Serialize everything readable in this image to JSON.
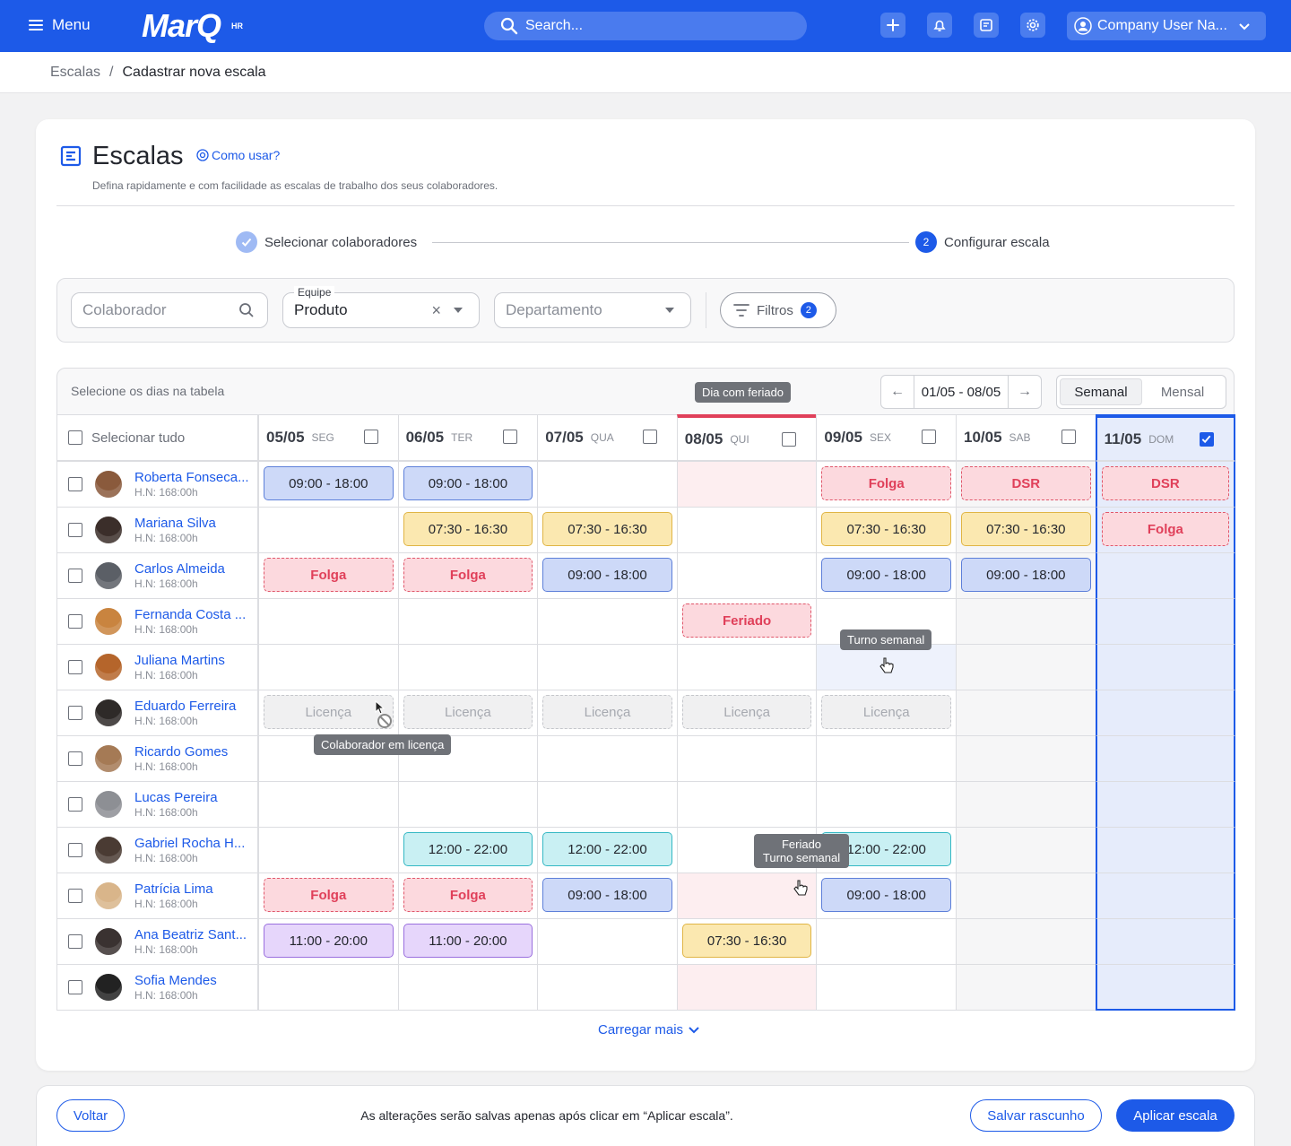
{
  "topbar": {
    "menu_label": "Menu",
    "logo_text": "MarQ",
    "logo_sup": "HR",
    "search_placeholder": "Search...",
    "user_name": "Company User Na...",
    "icons": [
      "plus-icon",
      "bell-icon",
      "notes-icon",
      "gear-icon"
    ]
  },
  "breadcrumb": {
    "parent": "Escalas",
    "separator": "/",
    "current": "Cadastrar nova escala"
  },
  "page": {
    "title": "Escalas",
    "how_to": "Como usar?",
    "subtitle": "Defina rapidamente e com facilidade as escalas de trabalho dos seus colaboradores."
  },
  "stepper": {
    "step1_label": "Selecionar colaboradores",
    "step2_number": "2",
    "step2_label": "Configurar escala"
  },
  "filters": {
    "colaborador_placeholder": "Colaborador",
    "equipe_label": "Equipe",
    "equipe_value": "Produto",
    "departamento_placeholder": "Departamento",
    "filtros_label": "Filtros",
    "filtros_count": "2"
  },
  "table": {
    "hint": "Selecione os dias na tabela",
    "range": "01/05 - 08/05",
    "view_weekly": "Semanal",
    "view_monthly": "Mensal",
    "select_all": "Selecionar tudo",
    "days": [
      {
        "date": "05/05",
        "dow": "SEG",
        "checked": false,
        "holiday": false
      },
      {
        "date": "06/05",
        "dow": "TER",
        "checked": false,
        "holiday": false
      },
      {
        "date": "07/05",
        "dow": "QUA",
        "checked": false,
        "holiday": false
      },
      {
        "date": "08/05",
        "dow": "QUI",
        "checked": false,
        "holiday": true
      },
      {
        "date": "09/05",
        "dow": "SEX",
        "checked": false,
        "holiday": false
      },
      {
        "date": "10/05",
        "dow": "SAB",
        "checked": false,
        "holiday": false
      },
      {
        "date": "11/05",
        "dow": "DOM",
        "checked": true,
        "holiday": false
      }
    ],
    "rows": [
      {
        "name": "Roberta Fonseca...",
        "hours": "H.N: 168:00h",
        "avatar": "#8a5a3c",
        "cells": [
          [
            "09:00 - 18:00",
            "blue"
          ],
          [
            "09:00 - 18:00",
            "blue"
          ],
          null,
          null,
          [
            "Folga",
            "red"
          ],
          [
            "DSR",
            "red"
          ],
          [
            "DSR",
            "red"
          ]
        ]
      },
      {
        "name": "Mariana Silva",
        "hours": "H.N: 168:00h",
        "avatar": "#3b2e2a",
        "cells": [
          null,
          [
            "07:30 - 16:30",
            "yellow"
          ],
          [
            "07:30 - 16:30",
            "yellow"
          ],
          null,
          [
            "07:30 - 16:30",
            "yellow"
          ],
          [
            "07:30 - 16:30",
            "yellow"
          ],
          [
            "Folga",
            "red"
          ]
        ]
      },
      {
        "name": "Carlos Almeida",
        "hours": "H.N: 168:00h",
        "avatar": "#5b5f66",
        "cells": [
          [
            "Folga",
            "red"
          ],
          [
            "Folga",
            "red"
          ],
          [
            "09:00 - 18:00",
            "blue"
          ],
          null,
          [
            "09:00 - 18:00",
            "blue"
          ],
          [
            "09:00 - 18:00",
            "blue"
          ],
          null
        ]
      },
      {
        "name": "Fernanda Costa ...",
        "hours": "H.N: 168:00h",
        "avatar": "#c9843f",
        "cells": [
          null,
          null,
          null,
          [
            "Feriado",
            "red"
          ],
          null,
          null,
          null
        ]
      },
      {
        "name": "Juliana Martins",
        "hours": "H.N: 168:00h",
        "avatar": "#b5652b",
        "cells": [
          null,
          null,
          null,
          null,
          null,
          null,
          null
        ]
      },
      {
        "name": "Eduardo Ferreira",
        "hours": "H.N: 168:00h",
        "avatar": "#2e2a28",
        "cells": [
          [
            "Licença",
            "gray"
          ],
          [
            "Licença",
            "gray"
          ],
          [
            "Licença",
            "gray"
          ],
          [
            "Licença",
            "gray"
          ],
          [
            "Licença",
            "gray"
          ],
          null,
          null
        ]
      },
      {
        "name": "Ricardo Gomes",
        "hours": "H.N: 168:00h",
        "avatar": "#a57a55",
        "cells": [
          null,
          null,
          null,
          null,
          null,
          null,
          null
        ]
      },
      {
        "name": "Lucas Pereira",
        "hours": "H.N: 168:00h",
        "avatar": "#8d8f94",
        "cells": [
          null,
          null,
          null,
          null,
          null,
          null,
          null
        ]
      },
      {
        "name": "Gabriel Rocha H...",
        "hours": "H.N: 168:00h",
        "avatar": "#4a3b33",
        "cells": [
          null,
          [
            "12:00 - 22:00",
            "cyan"
          ],
          [
            "12:00 - 22:00",
            "cyan"
          ],
          null,
          [
            "12:00 - 22:00",
            "cyan"
          ],
          null,
          null
        ]
      },
      {
        "name": "Patrícia Lima",
        "hours": "H.N: 168:00h",
        "avatar": "#d9b58a",
        "cells": [
          [
            "Folga",
            "red"
          ],
          [
            "Folga",
            "red"
          ],
          [
            "09:00 - 18:00",
            "blue"
          ],
          null,
          [
            "09:00 - 18:00",
            "blue"
          ],
          null,
          null
        ]
      },
      {
        "name": "Ana Beatriz Sant...",
        "hours": "H.N: 168:00h",
        "avatar": "#3a3231",
        "cells": [
          [
            "11:00 - 20:00",
            "purple"
          ],
          [
            "11:00 - 20:00",
            "purple"
          ],
          null,
          [
            "07:30 - 16:30",
            "yellow"
          ],
          null,
          null,
          null
        ]
      },
      {
        "name": "Sofia Mendes",
        "hours": "H.N: 168:00h",
        "avatar": "#222",
        "cells": [
          null,
          null,
          null,
          null,
          null,
          null,
          null
        ]
      }
    ],
    "load_more": "Carregar mais"
  },
  "tooltips": {
    "holiday_day": "Dia com feriado",
    "weekly_shift": "Turno semanal",
    "on_leave": "Colaborador em licença",
    "holiday_line1": "Feriado",
    "holiday_line2": "Turno semanal"
  },
  "footer": {
    "back": "Voltar",
    "message": "As alterações serão salvas apenas após clicar em “Aplicar escala”.",
    "save_draft": "Salvar rascunho",
    "apply": "Aplicar escala"
  },
  "colors": {
    "primary": "#1d5ae8",
    "blue_chip": "#cdd9f8",
    "yellow_chip": "#fbe8b0",
    "red_chip": "#fcd9de",
    "cyan_chip": "#c9f0f3",
    "purple_chip": "#e6d6fb",
    "holiday_col": "#fdeef0",
    "selected_col": "#e6ecfb"
  }
}
